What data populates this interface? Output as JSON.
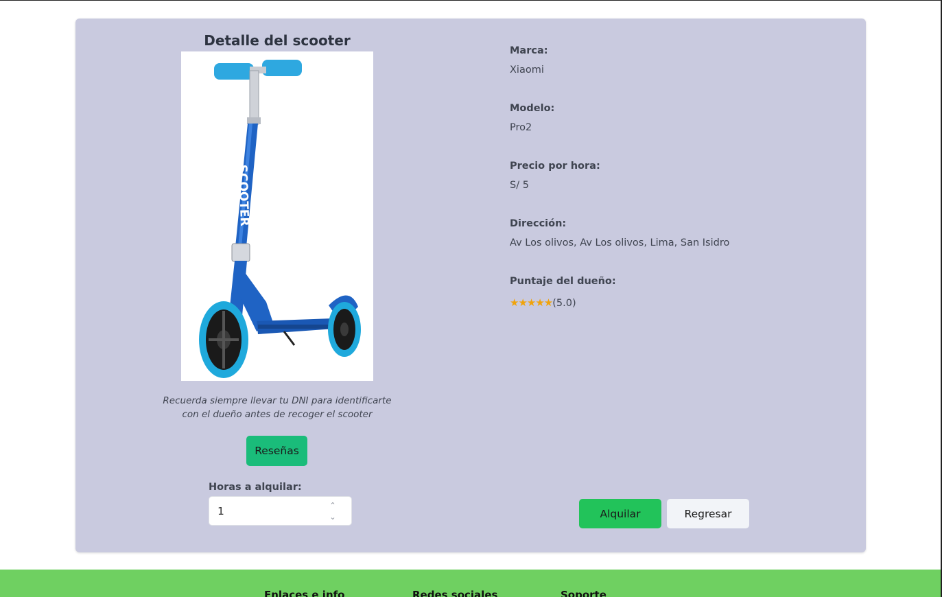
{
  "detail": {
    "title": "Detalle del scooter",
    "image_alt": "Scooter azul",
    "image_text": "SCOOTER",
    "note": "Recuerda siempre llevar tu DNI para identificarte con el dueño antes de recoger el scooter",
    "reviews_label": "Reseñas",
    "hours_label": "Horas a alquilar:",
    "hours_value": "1"
  },
  "info": {
    "brand_label": "Marca:",
    "brand_value": "Xiaomi",
    "model_label": "Modelo:",
    "model_value": "Pro2",
    "price_label": "Precio por hora:",
    "price_value": "S/ 5",
    "address_label": "Dirección:",
    "address_value": "Av Los olivos, Av Los olivos, Lima, San Isidro",
    "owner_score_label": "Puntaje del dueño:",
    "owner_stars": "★★★★★",
    "owner_score_value": "(5.0)",
    "owner_score": 5.0
  },
  "actions": {
    "rent_label": "Alquilar",
    "back_label": "Regresar"
  },
  "footer": {
    "columns": [
      "Enlaces e info",
      "Redes sociales",
      "Soporte"
    ]
  },
  "colors": {
    "card_bg": "#c9cadf",
    "reviews_btn": "#1abc7a",
    "rent_btn": "#22c35a",
    "back_btn": "#f2f4f8",
    "footer_bg": "#6fd061",
    "stars": "#f0a30a",
    "scooter_blue": "#1f63c4",
    "wheel_cyan": "#1fa9dc"
  }
}
